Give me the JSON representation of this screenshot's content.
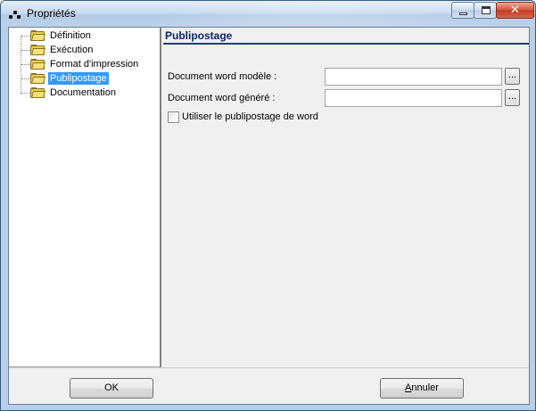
{
  "window": {
    "title": "Propriétés"
  },
  "tree": {
    "items": [
      {
        "label": "Définition",
        "selected": false
      },
      {
        "label": "Exécution",
        "selected": false
      },
      {
        "label": "Format d'impression",
        "selected": false
      },
      {
        "label": "Publipostage",
        "selected": true
      },
      {
        "label": "Documentation",
        "selected": false
      }
    ]
  },
  "panel": {
    "title": "Publipostage",
    "fields": [
      {
        "label": "Document word modèle :",
        "value": "",
        "browse_label": "..."
      },
      {
        "label": "Document word généré :",
        "value": "",
        "browse_label": "..."
      }
    ],
    "checkbox": {
      "label": "Utiliser le publipostage de word",
      "checked": false
    }
  },
  "buttons": {
    "ok_label": "OK",
    "cancel_label_mnemonic": "A",
    "cancel_label_rest": "nnuler"
  },
  "colors": {
    "selection": "#3399ff",
    "panel_header_rule": "#1f3f73",
    "close_button": "#c13a21"
  }
}
